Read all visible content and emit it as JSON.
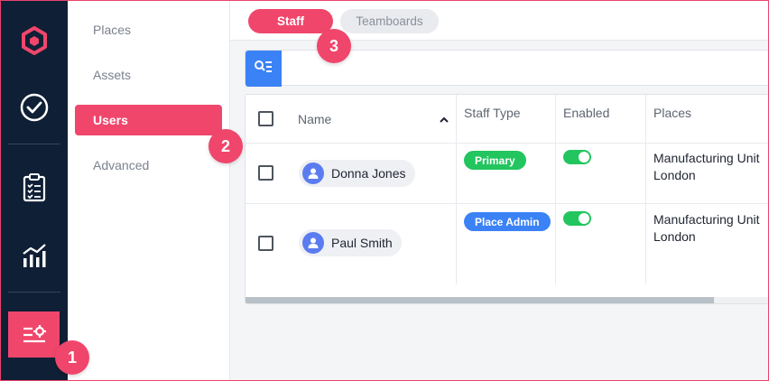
{
  "colors": {
    "accent": "#f0466c",
    "rail": "#0f1f35",
    "primary_blue": "#3b82f6",
    "green": "#22c55e"
  },
  "rail": {
    "icons": [
      "logo-hexagon-icon",
      "check-circle-icon",
      "clipboard-checklist-icon",
      "analytics-chart-icon",
      "settings-sliders-icon"
    ]
  },
  "subnav": {
    "items": [
      {
        "label": "Places"
      },
      {
        "label": "Assets"
      },
      {
        "label": "Users",
        "active": true
      },
      {
        "label": "Advanced"
      }
    ]
  },
  "tabs": [
    {
      "label": "Staff",
      "active": true
    },
    {
      "label": "Teamboards"
    }
  ],
  "table": {
    "headers": {
      "name": "Name",
      "staff_type": "Staff Type",
      "enabled": "Enabled",
      "places": "Places"
    },
    "rows": [
      {
        "name": "Donna Jones",
        "staff_type": "Primary",
        "staff_type_color": "#22c55e",
        "enabled": true,
        "place_line1": "Manufacturing Unit",
        "place_line2": "London"
      },
      {
        "name": "Paul Smith",
        "staff_type": "Place Admin",
        "staff_type_color": "#3b82f6",
        "enabled": true,
        "place_line1": "Manufacturing Unit",
        "place_line2": "London"
      }
    ]
  },
  "steps": {
    "one": "1",
    "two": "2",
    "three": "3"
  }
}
